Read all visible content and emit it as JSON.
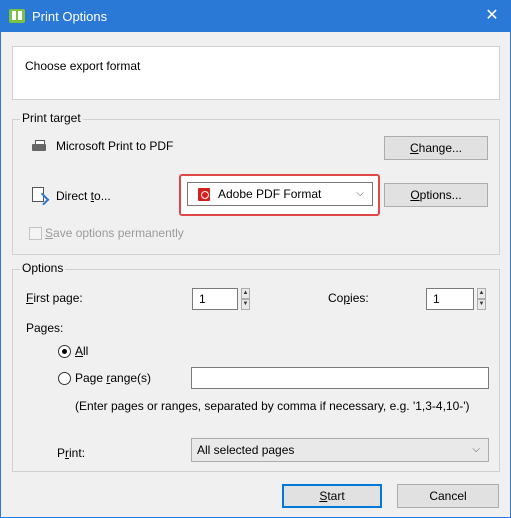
{
  "window": {
    "title": "Print Options",
    "close_symbol": "✕"
  },
  "header": {
    "text": "Choose export format"
  },
  "print_target": {
    "legend": "Print target",
    "printer_name": "Microsoft Print to PDF",
    "change_button": {
      "label_mnemonic": "C",
      "label_rest": "hange..."
    },
    "direct_to_label": {
      "prefix": "Direct ",
      "mnemonic": "t",
      "suffix": "o..."
    },
    "format_select": {
      "value": "Adobe PDF Format"
    },
    "options_button": {
      "label_mnemonic": "O",
      "label_rest": "ptions..."
    },
    "save_options": {
      "mnemonic": "S",
      "rest": "ave options permanently",
      "checked": false,
      "enabled": false
    }
  },
  "options": {
    "legend": "Options",
    "first_page": {
      "label_mnemonic": "F",
      "label_rest": "irst page:",
      "value": "1"
    },
    "copies": {
      "label_prefix": "Co",
      "label_mnemonic": "p",
      "label_rest": "ies:",
      "value": "1"
    },
    "pages_label": "Pages:",
    "radio_all": {
      "mnemonic": "A",
      "rest": "ll",
      "checked": true
    },
    "radio_range": {
      "prefix": "Page ",
      "mnemonic": "r",
      "rest": "ange(s)",
      "checked": false,
      "value": ""
    },
    "hint": "(Enter pages or ranges, separated by comma if necessary, e.g. '1,3-4,10-')",
    "print_label": {
      "prefix": "P",
      "mnemonic": "r",
      "rest": "int:"
    },
    "print_select": {
      "value": "All selected pages"
    }
  },
  "footer": {
    "start_button": {
      "mnemonic": "S",
      "rest": "tart"
    },
    "cancel_button": {
      "label": "Cancel"
    }
  },
  "colors": {
    "titlebar": "#2b79d6",
    "highlight": "#e04848",
    "pdf_red": "#d81f1f",
    "app_green": "#7bc242"
  },
  "icons": [
    "app-icon",
    "close-icon",
    "printer-icon",
    "document-arrow-icon",
    "pdf-icon",
    "chevron-down-icon",
    "spin-up-icon",
    "spin-down-icon"
  ]
}
